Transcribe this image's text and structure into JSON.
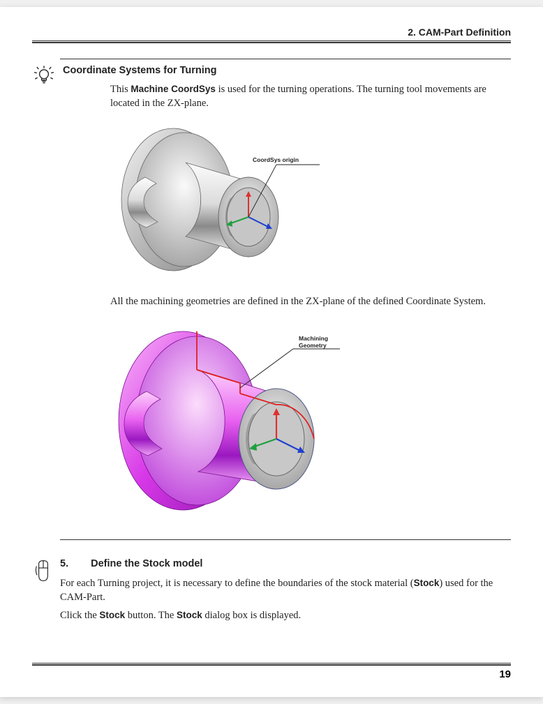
{
  "header": {
    "chapter": "2. CAM-Part Definition"
  },
  "tip": {
    "title": "Coordinate Systems for Turning",
    "p1_a": "This ",
    "p1_bold": "Machine CoordSys",
    "p1_b": " is used for the turning operations. The turning tool movements are located in the ZX-plane.",
    "fig1_label": "CoordSys origin",
    "p2": "All the machining geometries are defined in the ZX-plane of the defined Coordinate System.",
    "fig2_label1": "Machining",
    "fig2_label2": "Geometry"
  },
  "step": {
    "num": "5.",
    "title": "Define the Stock model",
    "p1_a": "For each Turning project, it is necessary to define the boundaries of the stock material (",
    "p1_bold": "Stock",
    "p1_b": ") used for the CAM-Part.",
    "p2_a": "Click the ",
    "p2_bold1": "Stock",
    "p2_b": " button. The ",
    "p2_bold2": "Stock",
    "p2_c": " dialog box is displayed."
  },
  "footer": {
    "page": "19"
  }
}
